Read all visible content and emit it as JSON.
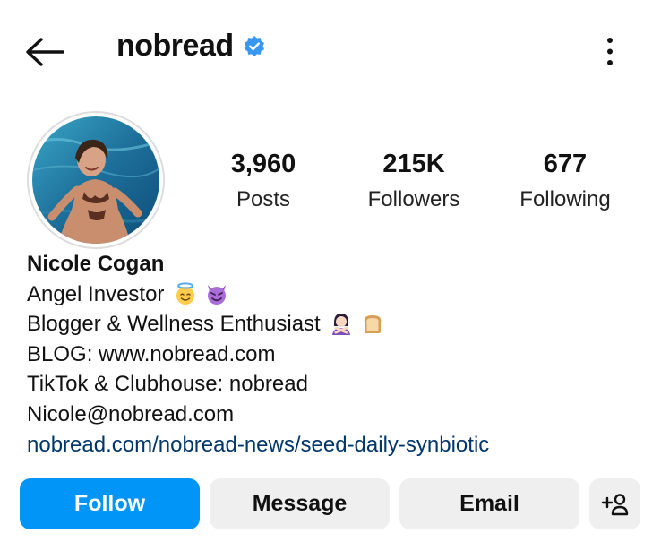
{
  "header": {
    "username": "nobread",
    "verified": true,
    "back_icon": "arrow-left-icon",
    "more_icon": "vertical-ellipsis-icon"
  },
  "profile": {
    "stats": [
      {
        "value": "3,960",
        "label": "Posts"
      },
      {
        "value": "215K",
        "label": "Followers"
      },
      {
        "value": "677",
        "label": "Following"
      }
    ],
    "bio": {
      "name": "Nicole Cogan",
      "line1": "Angel Investor",
      "line1_emojis": [
        "smiling-face-with-halo-emoji",
        "smiling-face-with-horns-emoji"
      ],
      "line2": "Blogger & Wellness Enthusiast",
      "line2_emojis": [
        "person-gesturing-no-emoji",
        "bread-emoji"
      ],
      "line3": "BLOG: www.nobread.com",
      "line4": "TikTok & Clubhouse: nobread",
      "line5": "Nicole@nobread.com",
      "link": "nobread.com/nobread-news/seed-daily-synbiotic"
    }
  },
  "actions": {
    "follow": "Follow",
    "message": "Message",
    "email": "Email",
    "add_user_icon": "add-user-icon"
  },
  "colors": {
    "accent": "#0095f6",
    "verified_badge": "#3897f0",
    "link": "#00376b",
    "button_bg": "#efefef"
  }
}
